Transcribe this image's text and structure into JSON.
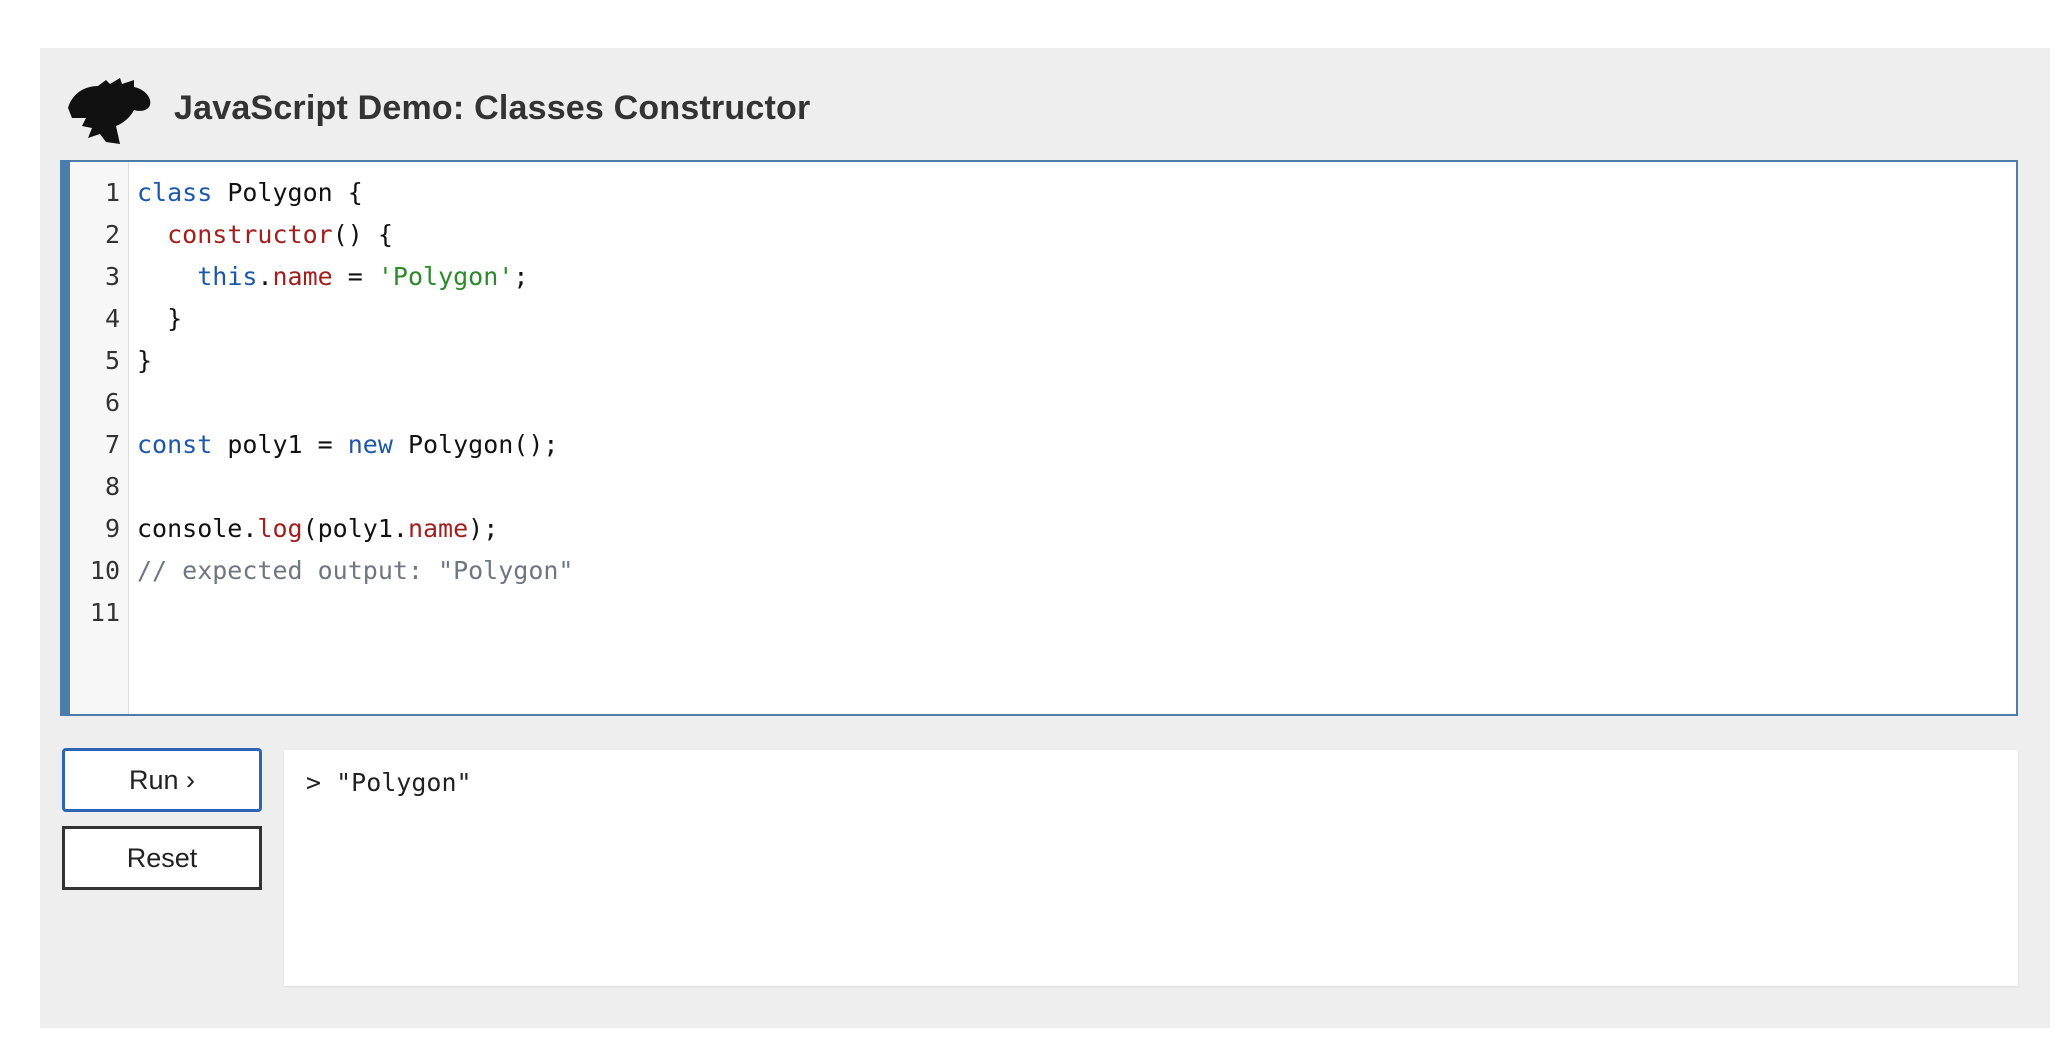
{
  "header": {
    "title": "JavaScript Demo: Classes Constructor",
    "logo_icon": "dinosaur-head-icon"
  },
  "editor": {
    "line_numbers": [
      "1",
      "2",
      "3",
      "4",
      "5",
      "6",
      "7",
      "8",
      "9",
      "10",
      "11"
    ],
    "lines": [
      [
        {
          "t": "kw",
          "v": "class"
        },
        {
          "t": "plain",
          "v": " Polygon {"
        }
      ],
      [
        {
          "t": "plain",
          "v": "  "
        },
        {
          "t": "prop",
          "v": "constructor"
        },
        {
          "t": "plain",
          "v": "() {"
        }
      ],
      [
        {
          "t": "plain",
          "v": "    "
        },
        {
          "t": "kw",
          "v": "this"
        },
        {
          "t": "plain",
          "v": "."
        },
        {
          "t": "prop",
          "v": "name"
        },
        {
          "t": "plain",
          "v": " = "
        },
        {
          "t": "str",
          "v": "'Polygon'"
        },
        {
          "t": "plain",
          "v": ";"
        }
      ],
      [
        {
          "t": "plain",
          "v": "  }"
        }
      ],
      [
        {
          "t": "plain",
          "v": "}"
        }
      ],
      [],
      [
        {
          "t": "kw",
          "v": "const"
        },
        {
          "t": "plain",
          "v": " poly1 = "
        },
        {
          "t": "kw",
          "v": "new"
        },
        {
          "t": "plain",
          "v": " Polygon();"
        }
      ],
      [],
      [
        {
          "t": "plain",
          "v": "console."
        },
        {
          "t": "prop",
          "v": "log"
        },
        {
          "t": "plain",
          "v": "(poly1."
        },
        {
          "t": "prop",
          "v": "name"
        },
        {
          "t": "plain",
          "v": ");"
        }
      ],
      [
        {
          "t": "comment",
          "v": "// expected output: \"Polygon\""
        }
      ],
      []
    ]
  },
  "controls": {
    "run_label": "Run ›",
    "reset_label": "Reset"
  },
  "output": {
    "text": "> \"Polygon\""
  },
  "colors": {
    "accent_border": "#4c7da8",
    "run_border": "#2f63b4",
    "keyword": "#1f57a8",
    "property": "#a01f1f",
    "string": "#2c8a2c",
    "comment": "#6e7780"
  }
}
